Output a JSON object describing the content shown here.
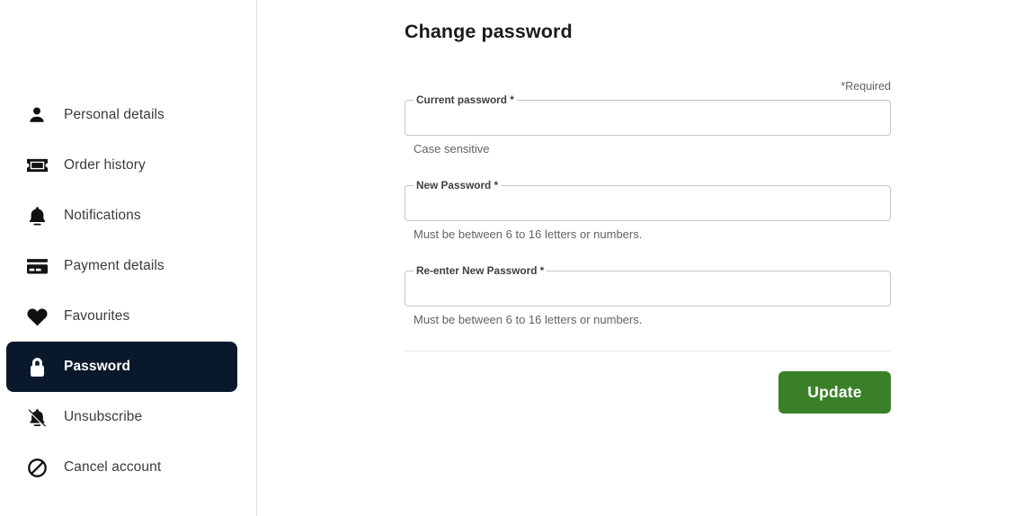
{
  "sidebar": {
    "items": [
      {
        "label": "Personal details",
        "icon": "person-icon",
        "active": false
      },
      {
        "label": "Order history",
        "icon": "ticket-icon",
        "active": false
      },
      {
        "label": "Notifications",
        "icon": "bell-icon",
        "active": false
      },
      {
        "label": "Payment details",
        "icon": "credit-card-icon",
        "active": false
      },
      {
        "label": "Favourites",
        "icon": "heart-icon",
        "active": false
      },
      {
        "label": "Password",
        "icon": "lock-icon",
        "active": true
      },
      {
        "label": "Unsubscribe",
        "icon": "bell-off-icon",
        "active": false
      },
      {
        "label": "Cancel account",
        "icon": "block-circle-icon",
        "active": false
      }
    ],
    "active_background": "#09192b",
    "active_text_color": "#ffffff"
  },
  "main": {
    "page_title": "Change password",
    "required_note": "*Required",
    "fields": [
      {
        "label": "Current password *",
        "value": "",
        "placeholder": "",
        "helper": "Case sensitive"
      },
      {
        "label": "New Password *",
        "value": "",
        "placeholder": "",
        "helper": "Must be between 6 to 16 letters or numbers."
      },
      {
        "label": "Re-enter New Password *",
        "value": "",
        "placeholder": "",
        "helper": "Must be between 6 to 16 letters or numbers."
      }
    ],
    "submit_label": "Update",
    "submit_color": "#3a8028"
  }
}
